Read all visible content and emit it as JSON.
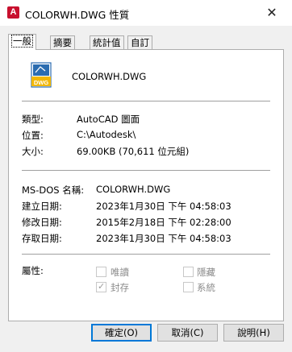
{
  "window": {
    "app_icon_letter": "A",
    "app_icon_name": "autocad-app-icon",
    "title": "COLORWH.DWG 性質",
    "close_label": "✕"
  },
  "tabs": [
    {
      "label": "一般",
      "active": true
    },
    {
      "label": "摘要",
      "active": false
    },
    {
      "label": "統計值",
      "active": false
    },
    {
      "label": "自訂",
      "active": false
    }
  ],
  "general": {
    "file_icon": "dwg-file-icon",
    "file_icon_text": "DWG",
    "filename": "COLORWH.DWG",
    "type_label": "類型:",
    "type_value": "AutoCAD 圖面",
    "location_label": "位置:",
    "location_value": "C:\\Autodesk\\",
    "size_label": "大小:",
    "size_value": "69.00KB (70,611 位元組)",
    "msdos_label": "MS-DOS 名稱:",
    "msdos_value": "COLORWH.DWG",
    "created_label": "建立日期:",
    "created_value": "2023年1月30日  下午 04:58:03",
    "modified_label": "修改日期:",
    "modified_value": "2015年2月18日  下午 02:28:00",
    "accessed_label": "存取日期:",
    "accessed_value": "2023年1月30日  下午 04:58:03",
    "attributes_label": "屬性:",
    "attributes": {
      "readonly": {
        "label": "唯讀",
        "checked": false
      },
      "hidden": {
        "label": "隱藏",
        "checked": false
      },
      "archive": {
        "label": "封存",
        "checked": true
      },
      "system": {
        "label": "系統",
        "checked": false
      }
    }
  },
  "buttons": {
    "ok": "確定(O)",
    "cancel": "取消(C)",
    "help": "說明(H)"
  },
  "colors": {
    "app_icon": "#c8102e",
    "file_icon_blue": "#2b6cb0",
    "file_icon_yellow": "#f2b705",
    "default_button_border": "#0078d7"
  }
}
